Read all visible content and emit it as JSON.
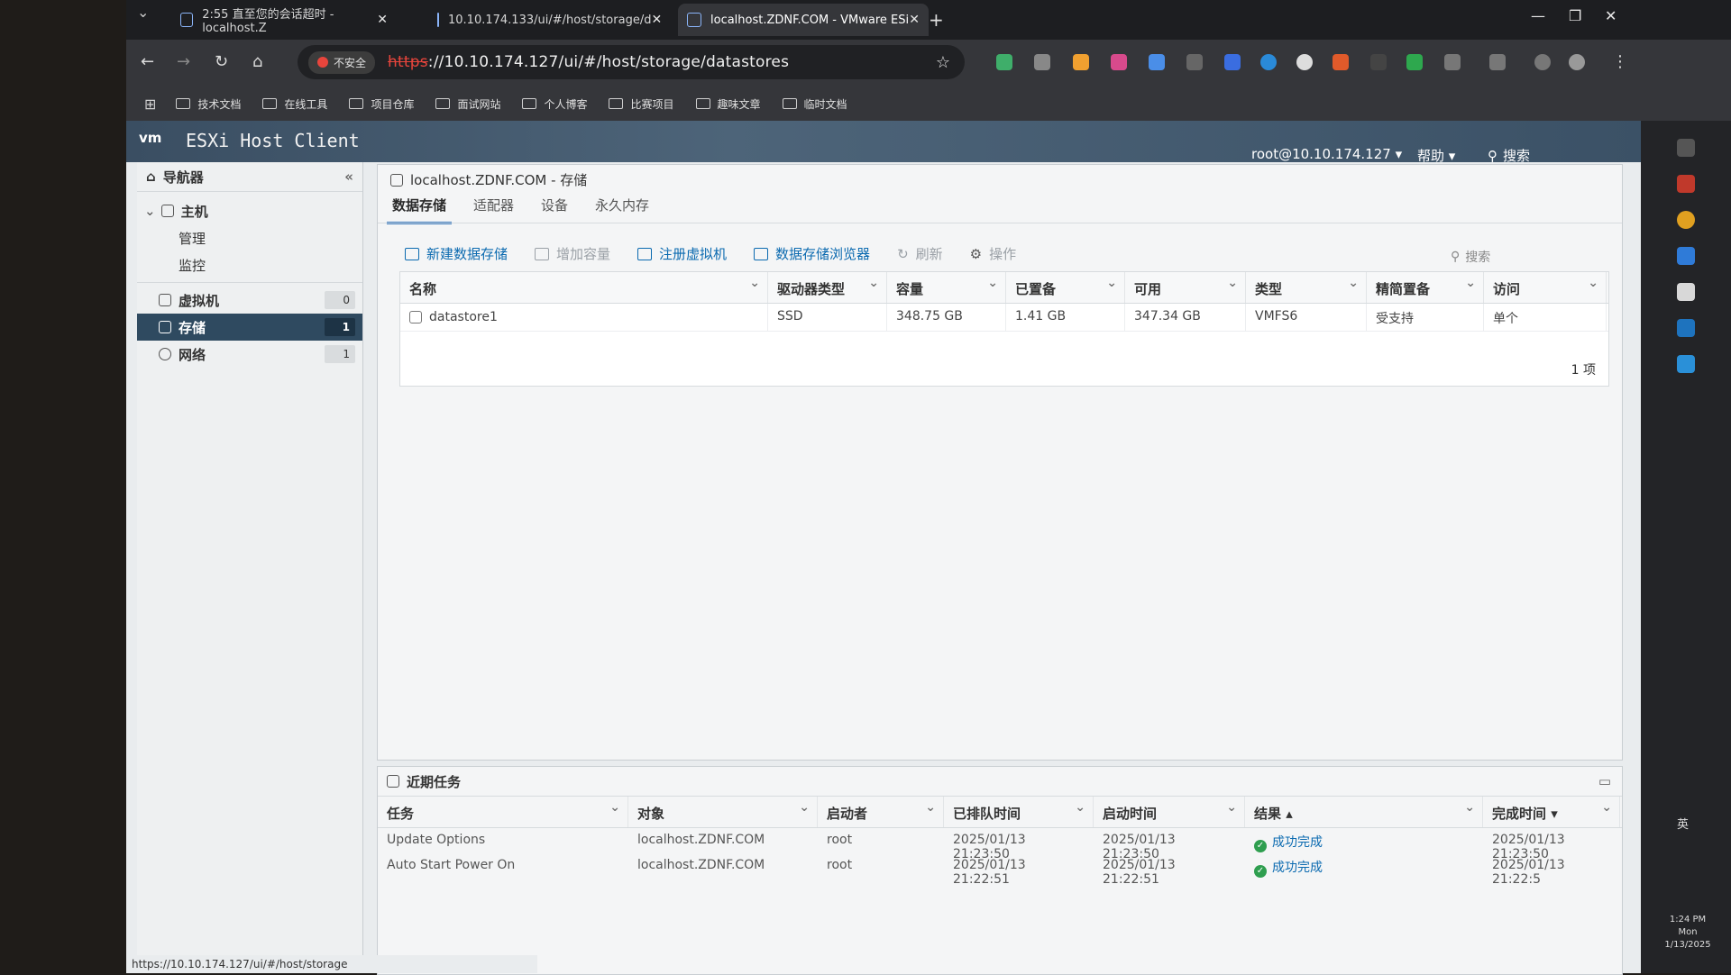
{
  "browser": {
    "tabs": [
      {
        "title": "2:55 直至您的会话超时 - localhost.Z",
        "active": false
      },
      {
        "title": "10.10.174.133/ui/#/host/storage/d",
        "active": false
      },
      {
        "title": "localhost.ZDNF.COM - VMware ESi",
        "active": true
      }
    ],
    "security_label": "不安全",
    "url_scheme": "https",
    "url_rest": "://10.10.174.127/ui/#/host/storage/datastores",
    "bookmarks": [
      "技术文档",
      "在线工具",
      "项目仓库",
      "面试网站",
      "个人博客",
      "比赛项目",
      "趣味文章",
      "临时文档"
    ],
    "status_url": "https://10.10.174.127/ui/#/host/storage"
  },
  "app": {
    "logo": "vm",
    "title": "ESXi Host Client",
    "user": "root@10.10.174.127 ▾",
    "help": "帮助 ▾",
    "search": "搜索"
  },
  "navigator": {
    "title": "导航器",
    "host_label": "主机",
    "host_children": [
      "管理",
      "监控"
    ],
    "items": [
      {
        "label": "虚拟机",
        "count": "0"
      },
      {
        "label": "存储",
        "count": "1"
      },
      {
        "label": "网络",
        "count": "1"
      }
    ]
  },
  "main": {
    "breadcrumb": "localhost.ZDNF.COM - 存储",
    "tabs": [
      "数据存储",
      "适配器",
      "设备",
      "永久内存"
    ],
    "actions": [
      {
        "label": "新建数据存储",
        "enabled": true
      },
      {
        "label": "增加容量",
        "enabled": false
      },
      {
        "label": "注册虚拟机",
        "enabled": true
      },
      {
        "label": "数据存储浏览器",
        "enabled": true
      },
      {
        "label": "刷新",
        "enabled": false
      },
      {
        "label": "操作",
        "enabled": false
      }
    ],
    "search_placeholder": "搜索",
    "columns": [
      "名称",
      "驱动器类型",
      "容量",
      "已置备",
      "可用",
      "类型",
      "精简置备",
      "访问"
    ],
    "rows": [
      [
        "datastore1",
        "SSD",
        "348.75 GB",
        "1.41 GB",
        "347.34 GB",
        "VMFS6",
        "受支持",
        "单个"
      ]
    ],
    "footer": "1 项"
  },
  "tasks": {
    "title": "近期任务",
    "columns": [
      "任务",
      "对象",
      "启动者",
      "已排队时间",
      "启动时间",
      "结果 ▴",
      "完成时间 ▾"
    ],
    "rows": [
      [
        "Update Options",
        "localhost.ZDNF.COM",
        "root",
        "2025/01/13 21:23:50",
        "2025/01/13 21:23:50",
        "成功完成",
        "2025/01/13 21:23:50"
      ],
      [
        "Auto Start Power On",
        "localhost.ZDNF.COM",
        "root",
        "2025/01/13 21:22:51",
        "2025/01/13 21:22:51",
        "成功完成",
        "2025/01/13 21:22:5"
      ]
    ]
  },
  "taskbar": {
    "time": "1:24 PM",
    "day": "Mon",
    "date": "1/13/2025",
    "ime": "英"
  }
}
